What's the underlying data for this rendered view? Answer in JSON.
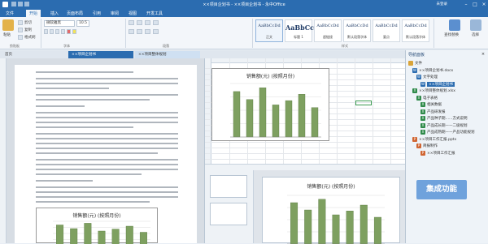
{
  "window": {
    "title": "××项目企划书 - ××项目企划书 - 永中Office",
    "user": "未登录"
  },
  "menu": [
    "文件",
    "开始",
    "插入",
    "页面布局",
    "引用",
    "审阅",
    "视图",
    "开发工具"
  ],
  "ribbon": {
    "clipboard": {
      "label": "剪贴板",
      "paste": "粘贴",
      "cut": "剪切",
      "copy": "复制",
      "format_painter": "格式刷"
    },
    "font": {
      "label": "字体",
      "font_name": "微软雅黑",
      "font_size": "10.5"
    },
    "paragraph": {
      "label": "段落"
    },
    "styles": {
      "label": "样式",
      "items": [
        {
          "preview": "AaBbCcDd",
          "name": "正文"
        },
        {
          "preview": "AaBbCc",
          "name": "标题 1"
        },
        {
          "preview": "AaBbCcDd",
          "name": "超链接"
        },
        {
          "preview": "AaBbCcDd",
          "name": "默认段落字体"
        },
        {
          "preview": "AaBbCcDd",
          "name": "要点"
        },
        {
          "preview": "AaBbCcDd",
          "name": "默认段落字体"
        }
      ]
    },
    "find": {
      "label": "查找替换"
    },
    "select": {
      "label": "选择"
    }
  },
  "tabs": [
    {
      "label": "首页"
    },
    {
      "label": "××项目企划书"
    },
    {
      "label": "××项目整体规划"
    }
  ],
  "doc": {
    "chart_title": "销售额(元) (按照月份)"
  },
  "sheet": {
    "chart_title": "销售额(元) (按照月份)"
  },
  "ppt": {
    "chart_title": "销售额(元) (按照月份)"
  },
  "nav": {
    "title": "导航面板",
    "items": [
      {
        "label": "文件",
        "kind": "folder",
        "level": 0
      },
      {
        "label": "××项目企划书.docx",
        "kind": "word",
        "level": 1
      },
      {
        "label": "文字处理",
        "kind": "word",
        "level": 2
      },
      {
        "label": "××项目企划书",
        "kind": "word",
        "level": 3,
        "selected": true
      },
      {
        "label": "××项目整体规划.xlsx",
        "kind": "excel",
        "level": 1
      },
      {
        "label": "电子表格",
        "kind": "excel",
        "level": 2
      },
      {
        "label": "相关数据",
        "kind": "excel",
        "level": 3
      },
      {
        "label": "产品研发报",
        "kind": "excel",
        "level": 3
      },
      {
        "label": "产品种子期……方式说明",
        "kind": "excel",
        "level": 3
      },
      {
        "label": "产品成长期——二级规划",
        "kind": "excel",
        "level": 3
      },
      {
        "label": "产品成熟期——产品功能规划",
        "kind": "excel",
        "level": 3
      },
      {
        "label": "××项目工作汇报.pptx",
        "kind": "ppt",
        "level": 1
      },
      {
        "label": "简报制作",
        "kind": "ppt",
        "level": 2
      },
      {
        "label": "××项目工作汇报",
        "kind": "ppt",
        "level": 3
      }
    ]
  },
  "success_badge": "集成功能",
  "chart_data": [
    {
      "type": "bar",
      "title": "销售额(元) (按照月份)",
      "categories": [
        "1",
        "2",
        "3",
        "4",
        "5",
        "6",
        "7"
      ],
      "values": [
        85,
        70,
        92,
        60,
        68,
        80,
        55
      ],
      "ylim": [
        0,
        100
      ],
      "grid": true,
      "colors": [
        "#7ea060"
      ]
    }
  ],
  "colors": {
    "accent": "#2b6cb0",
    "bar": "#7ea060",
    "badge": "#6fa2dc"
  }
}
